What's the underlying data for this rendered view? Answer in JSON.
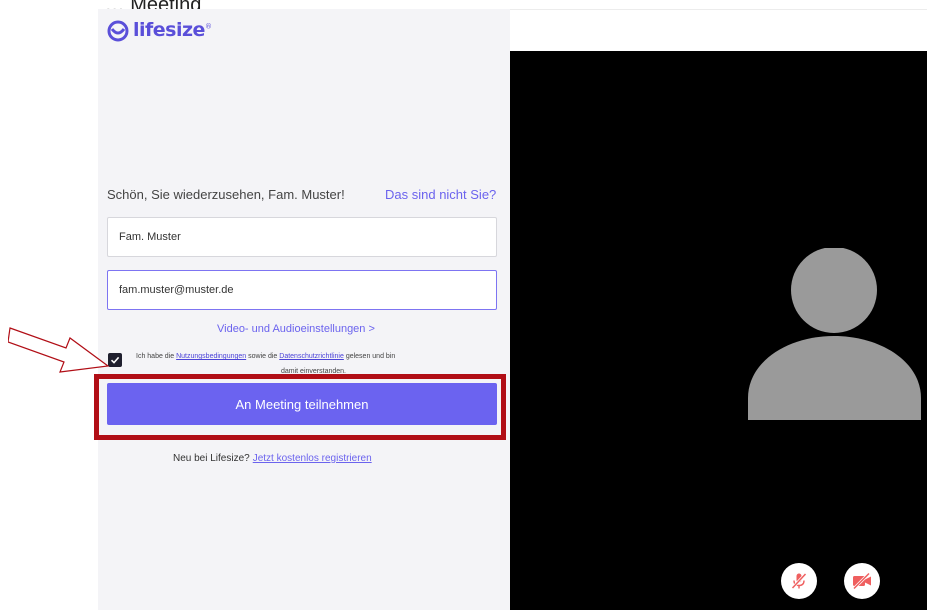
{
  "caption": "„… Meeting",
  "brand": {
    "name": "lifesize",
    "tm": "®",
    "color": "#5a4fd9"
  },
  "greeting": "Schön, Sie wiederzusehen, Fam. Muster!",
  "not_you_link": "Das sind nicht Sie?",
  "fields": {
    "name_value": "Fam. Muster",
    "email_value": "fam.muster@muster.de"
  },
  "av_settings_link": "Video- und Audioeinstellungen >",
  "consent": {
    "checked": true,
    "prefix": "Ich habe die",
    "terms_link": "Nutzungsbedingungen",
    "middle": "sowie die",
    "privacy_link": "Datenschutzrichtlinie",
    "suffix": "gelesen und bin",
    "line2": "damit einverstanden."
  },
  "join_button": "An Meeting teilnehmen",
  "register": {
    "text": "Neu bei Lifesize?",
    "link": "Jetzt kostenlos registrieren"
  },
  "controls": {
    "mic": "mic-muted-icon",
    "camera": "camera-off-icon"
  },
  "colors": {
    "accent": "#6b63f0",
    "highlight": "#b10e16",
    "control_icon": "#ef5f5f"
  }
}
